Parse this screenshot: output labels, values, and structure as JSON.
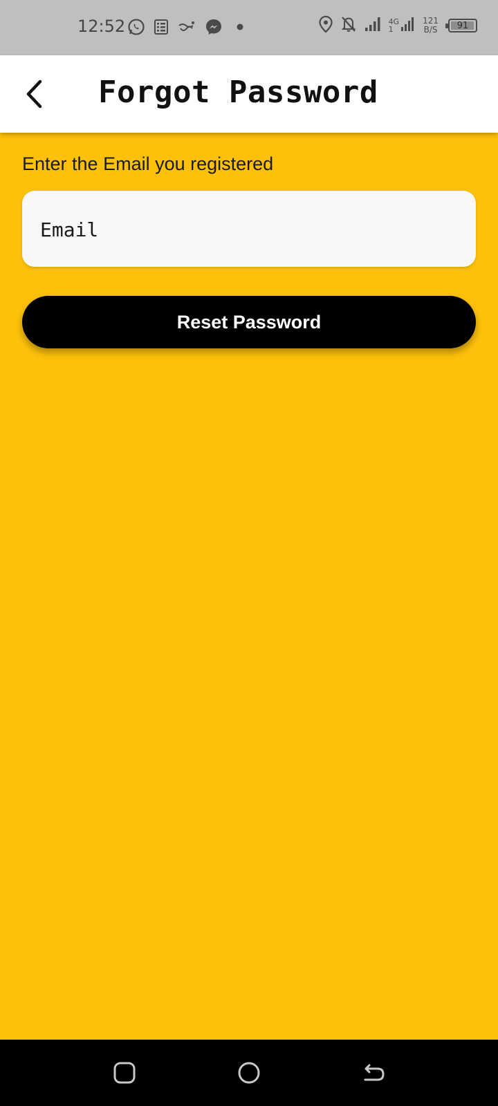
{
  "status_bar": {
    "time": "12:52",
    "left_icons": [
      "whatsapp-icon",
      "list-icon",
      "swiggy-icon",
      "messenger-icon",
      "dot-icon"
    ],
    "right_icons": [
      "location-icon",
      "bell-off-icon",
      "signal-icon",
      "signal-4g-icon"
    ],
    "network_type": "4G",
    "network_sub": "1",
    "net_speed_value": "121",
    "net_speed_unit": "B/S",
    "battery_level": "91"
  },
  "app_bar": {
    "title": "Forgot Password",
    "back_icon": "chevron-left-icon"
  },
  "form": {
    "instruction": "Enter the Email you registered",
    "email_placeholder": "Email",
    "email_value": "",
    "reset_button_label": "Reset Password"
  },
  "nav_bar": {
    "buttons": [
      "recent-apps-icon",
      "home-icon",
      "back-icon"
    ]
  },
  "colors": {
    "background": "#FDC10B",
    "app_bar": "#FFFFFF",
    "status_bar": "#BFBFBF",
    "button": "#000000",
    "field": "#F8F8F8"
  }
}
